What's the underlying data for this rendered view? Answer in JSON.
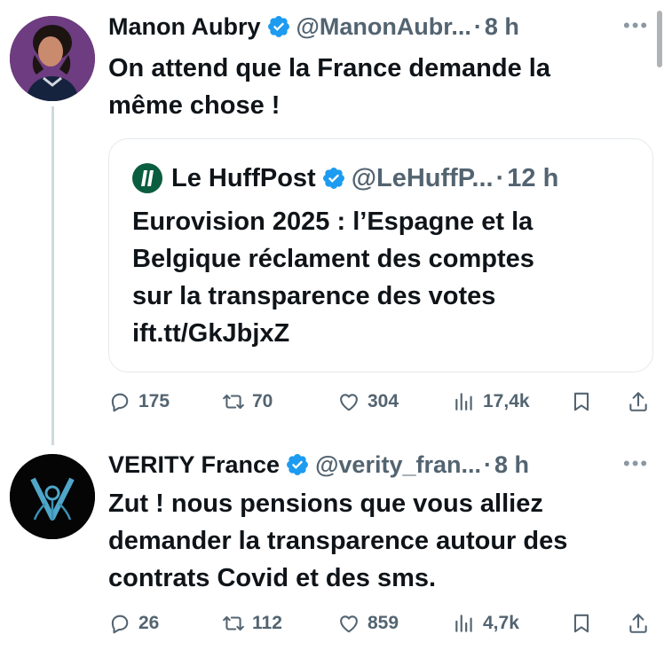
{
  "tweets": [
    {
      "display_name": "Manon Aubry",
      "handle": "@ManonAubr...",
      "dot": "·",
      "time": "8 h",
      "text_lines": [
        "On attend que la France demande la",
        "même chose !"
      ],
      "quote": {
        "display_name": "Le HuffPost",
        "handle": "@LeHuffP...",
        "dot": "·",
        "time": "12 h",
        "text_lines": [
          "Eurovision 2025 : l’Espagne et la",
          "Belgique réclament des comptes",
          "sur la transparence des votes",
          "ift.tt/GkJbjxZ"
        ]
      },
      "stats": {
        "replies": "175",
        "retweets": "70",
        "likes": "304",
        "views": "17,4k"
      }
    },
    {
      "display_name": "VERITY France",
      "handle": "@verity_fran...",
      "dot": "·",
      "time": "8 h",
      "text_lines": [
        "Zut ! nous pensions que vous alliez",
        "demander la transparence autour des",
        "contrats Covid et des sms."
      ],
      "stats": {
        "replies": "26",
        "retweets": "112",
        "likes": "859",
        "views": "4,7k"
      }
    }
  ],
  "icons": {
    "verified": "verified-badge-icon",
    "more": "more-options-icon",
    "reply": "reply-icon",
    "retweet": "retweet-icon",
    "like": "heart-icon",
    "views": "views-icon",
    "bookmark": "bookmark-icon",
    "share": "share-icon"
  },
  "colors": {
    "text": "#0f1419",
    "secondary": "#536471",
    "verified": "#1d9bf0",
    "border": "#e4e9ec"
  }
}
